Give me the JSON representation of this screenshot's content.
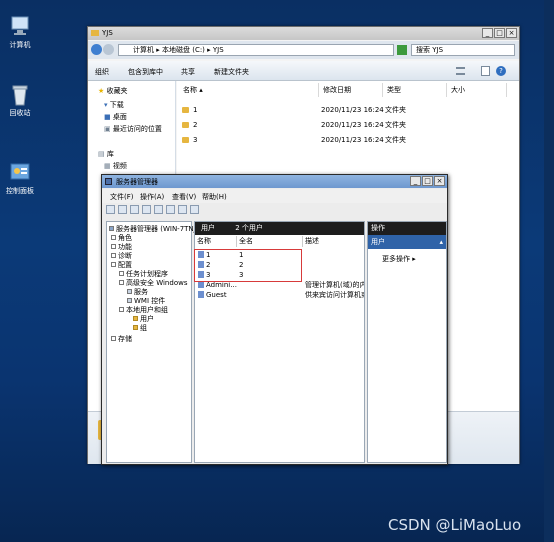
{
  "desktop": {
    "icons": [
      {
        "label": "计算机",
        "icon": "computer-icon"
      },
      {
        "label": "回收站",
        "icon": "recycle-bin-icon"
      },
      {
        "label": "控制面板",
        "icon": "control-panel-icon"
      }
    ]
  },
  "explorer": {
    "title": "YJS",
    "address": [
      "计算机",
      "本地磁盘 (C:)",
      "YJS"
    ],
    "address_sep": "▸",
    "search_placeholder": "搜索 YJS",
    "toolbar": {
      "organize": "组织",
      "include": "包含到库中",
      "share": "共享",
      "new_folder": "新建文件夹"
    },
    "nav": {
      "favorites": "收藏夹",
      "downloads": "下载",
      "desktop": "桌面",
      "recent": "最近访问的位置",
      "libraries": "库",
      "videos": "视频"
    },
    "columns": {
      "name": "名称",
      "date": "修改日期",
      "type": "类型",
      "size": "大小"
    },
    "files": [
      {
        "name": "1",
        "date": "2020/11/23 16:24",
        "type": "文件夹"
      },
      {
        "name": "2",
        "date": "2020/11/23 16:24",
        "type": "文件夹"
      },
      {
        "name": "3",
        "date": "2020/11/23 16:24",
        "type": "文件夹"
      }
    ]
  },
  "server_manager": {
    "title": "服务器管理器",
    "menu": {
      "file": "文件(F)",
      "action": "操作(A)",
      "view": "查看(V)",
      "help": "帮助(H)"
    },
    "tree": {
      "root": "服务器管理器 (WIN-7TNJ",
      "roles": "角色",
      "features": "功能",
      "diagnostics": "诊断",
      "configuration": "配置",
      "task_scheduler": "任务计划程序",
      "firewall": "高级安全 Windows",
      "services": "服务",
      "wmi": "WMI 控件",
      "local_users": "本地用户和组",
      "users": "用户",
      "groups": "组",
      "storage": "存储"
    },
    "list_header": {
      "title": "用户",
      "count": "2 个用户"
    },
    "list_columns": {
      "name": "名称",
      "full_name": "全名",
      "description": "描述"
    },
    "users": [
      {
        "name": "1",
        "full_name": "1",
        "description": ""
      },
      {
        "name": "2",
        "full_name": "2",
        "description": ""
      },
      {
        "name": "3",
        "full_name": "3",
        "description": ""
      },
      {
        "name": "Admini...",
        "full_name": "",
        "description": "管理计算机(域)的内"
      },
      {
        "name": "Guest",
        "full_name": "",
        "description": "供来宾访问计算机或"
      }
    ],
    "actions": {
      "header": "操作",
      "section": "用户",
      "more": "更多操作"
    }
  },
  "watermark": "CSDN @LiMaoLuo",
  "colors": {
    "desktop": "#0b3a78",
    "action_section": "#2f63a8",
    "highlight_box": "#d73a3a"
  }
}
